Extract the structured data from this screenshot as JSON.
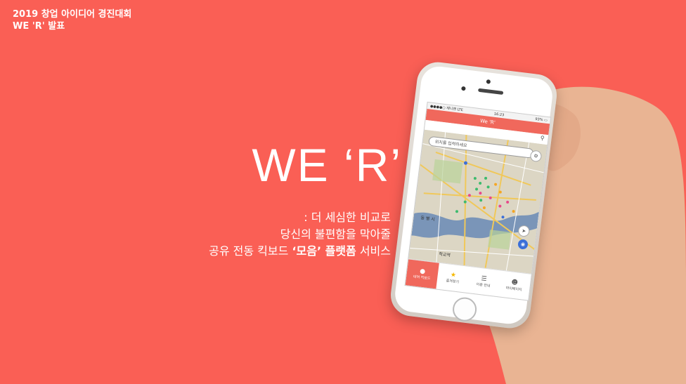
{
  "header": {
    "line1": "2019 창업 아이디어 경진대회",
    "line2": "WE 'R' 발표"
  },
  "hero": {
    "title": "WE ‘R’",
    "sub_line1": ":  더 세심한 비교로",
    "sub_line2": "당신의 불편함을 막아줄",
    "sub_line3_a": "공유 전동 킥보드 ",
    "sub_line3_b": "‘모음’ 플랫폼",
    "sub_line3_c": " 서비스"
  },
  "app": {
    "status_left": "●●●●○ 제니앤 LTE",
    "status_center": "16:23",
    "status_right": "93% ▭",
    "title": "We 'R'",
    "search_placeholder": "위치를 입력하세요",
    "map_label_1": "동 별 시",
    "map_label_2": "학교역",
    "tabs": [
      {
        "icon": "location-pin-icon",
        "label": "대여 킥보드"
      },
      {
        "icon": "star-icon",
        "label": "즐겨찾기"
      },
      {
        "icon": "list-icon",
        "label": "이용 안내"
      },
      {
        "icon": "person-icon",
        "label": "마이페이지"
      }
    ]
  },
  "colors": {
    "background": "#FA5F55",
    "accent": "#F0685C"
  }
}
